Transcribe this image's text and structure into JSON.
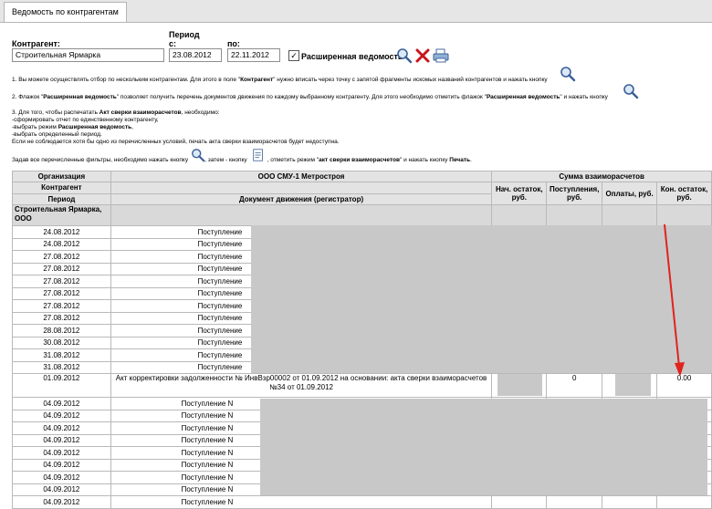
{
  "tab": {
    "label": "Ведомость по контрагентам"
  },
  "filters": {
    "counterparty_label": "Контрагент:",
    "counterparty_value": "Строительная Ярмарка",
    "period_label": "Период",
    "from_label": "с:",
    "from_value": "23.08.2012",
    "to_label": "по:",
    "to_value": "22.11.2012",
    "extended_checked": "✓",
    "extended_label": "Расширенная ведомость"
  },
  "icons": {
    "search": "search-icon",
    "clear": "clear-x-icon",
    "print": "printer-icon",
    "doc": "doc-icon"
  },
  "notes": {
    "n1_pre": "1. Вы можете осуществлять отбор по нескольким контрагентам. Для этого в поле \"",
    "n1_bold": "Контрагент",
    "n1_post": "\" нужно вписать через точку с запятой фрагменты искомых названий контрагентов и нажать кнопку",
    "n2_pre": "2. Флажок \"",
    "n2_bold1": "Расширенная ведомость",
    "n2_mid": "\" позволяет получить перечень документов движения по каждому выбранному контрагенту. Для этого необходимо отметить флажок \"",
    "n2_bold2": "Расширенная ведомость",
    "n2_post": "\" и нажать кнопку",
    "n3_pre": "3. Для того, чтобы распечатать ",
    "n3_bold": "Акт сверки взаиморасчетов",
    "n3_post": ", необходимо:",
    "n3_a": "-сформировать отчет по единственному контрагенту,",
    "n3_b_pre": "-выбрать режим ",
    "n3_b_bold": "Расширенная ведомость",
    "n3_b_post": ",",
    "n3_c": "-выбрать определенный период.",
    "n3_d": "Если не соблюдается хотя бы одно из перечисленных условий, печать акта сверки взаиморасчетов будет недоступна.",
    "n4_a": "Задав все перечисленные фильтры, необходимо нажать кнопку",
    "n4_b": ", затем - кнопку",
    "n4_c": ", отметить режим \"",
    "n4_bold1": "акт сверки взаиморасчетов",
    "n4_d": "\" и нажать кнопку ",
    "n4_bold2": "Печать",
    "n4_e": "."
  },
  "table": {
    "h_org": "Организация",
    "h_org_value": "ООО СМУ-1 Метростроя",
    "h_sum": "Сумма взаиморасчетов",
    "h_contr": "Контрагент",
    "h_period": "Период",
    "h_doc": "Документ движения (регистратор)",
    "h_start": "Нач. остаток, руб.",
    "h_in": "Поступления, руб.",
    "h_pay": "Оплаты, руб.",
    "h_end": "Кон. остаток, руб.",
    "group_name": "Строительная Ярмарка, ООО",
    "rows": [
      {
        "date": "24.08.2012",
        "doc": "Поступление"
      },
      {
        "date": "24.08.2012",
        "doc": "Поступление"
      },
      {
        "date": "27.08.2012",
        "doc": "Поступление"
      },
      {
        "date": "27.08.2012",
        "doc": "Поступление"
      },
      {
        "date": "27.08.2012",
        "doc": "Поступление"
      },
      {
        "date": "27.08.2012",
        "doc": "Поступление"
      },
      {
        "date": "27.08.2012",
        "doc": "Поступление"
      },
      {
        "date": "27.08.2012",
        "doc": "Поступление"
      },
      {
        "date": "28.08.2012",
        "doc": "Поступление"
      },
      {
        "date": "30.08.2012",
        "doc": "Поступление"
      },
      {
        "date": "31.08.2012",
        "doc": "Поступление"
      },
      {
        "date": "31.08.2012",
        "doc": "Поступление"
      }
    ],
    "act_row": {
      "date": "01.09.2012",
      "doc_line1": "Акт корректировки задолженности № ИнвВзр00002 от 01.09.2012 на основании: акта сверки взаиморасчетов",
      "doc_line2": "№34 от 01.09.2012",
      "in": "0",
      "end": "0.00"
    },
    "rows2": [
      {
        "date": "04.09.2012",
        "doc": "Поступление N"
      },
      {
        "date": "04.09.2012",
        "doc": "Поступление N"
      },
      {
        "date": "04.09.2012",
        "doc": "Поступление N"
      },
      {
        "date": "04.09.2012",
        "doc": "Поступление N"
      },
      {
        "date": "04.09.2012",
        "doc": "Поступление N"
      },
      {
        "date": "04.09.2012",
        "doc": "Поступление N"
      },
      {
        "date": "04.09.2012",
        "doc": "Поступление N"
      },
      {
        "date": "04.09.2012",
        "doc": "Поступление N"
      },
      {
        "date": "04.09.2012",
        "doc": "Поступление N"
      }
    ]
  },
  "colors": {
    "arrow": "#e0231c",
    "mask": "#c8c8c8",
    "header": "#e3e3e3"
  }
}
